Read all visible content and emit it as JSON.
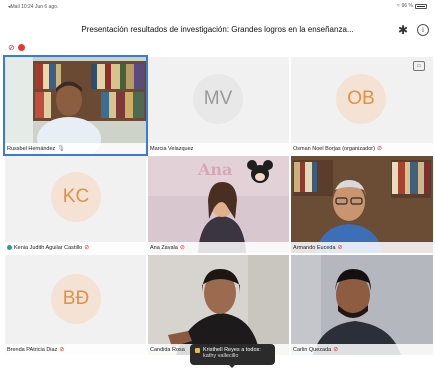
{
  "status_bar": {
    "left": "◂Mail 10:24 Jun 6 ago.",
    "right": "96 %"
  },
  "header": {
    "title": "Presentación resultados de investigación: Grandes logros en la enseñanza..."
  },
  "participants": [
    {
      "name": "Russbel Hernández",
      "type": "video",
      "mic": "on",
      "active": true
    },
    {
      "name": "Marcia Velazquez",
      "type": "initials",
      "initials": "MV",
      "mic": "none"
    },
    {
      "name": "Osman Noel Borjas (organizador)",
      "type": "initials",
      "initials": "OB",
      "mic": "muted"
    },
    {
      "name": "Kenia Judith Aguilar Castillo",
      "type": "initials",
      "initials": "KC",
      "mic": "muted"
    },
    {
      "name": "Ana Zavala",
      "type": "video",
      "mic": "muted"
    },
    {
      "name": "Armando Euceda",
      "type": "video",
      "mic": "muted"
    },
    {
      "name": "Brenda PAtricia Diaz",
      "type": "initials",
      "initials": "BĐ",
      "mic": "muted"
    },
    {
      "name": "Candida Rosa",
      "type": "video",
      "mic": "none"
    },
    {
      "name": "Carlin Quezada",
      "type": "video",
      "mic": "muted"
    }
  ],
  "chat": {
    "sender_line": "Kristhell Reyes a todos:",
    "message": "kathy vallecillo"
  },
  "wall_text": "Ana",
  "colors": {
    "avatar_orange": "#e39045",
    "avatar_bg": "#f4e3d4",
    "muted_mic": "#d33333",
    "active_border": "#3a7bd5"
  }
}
